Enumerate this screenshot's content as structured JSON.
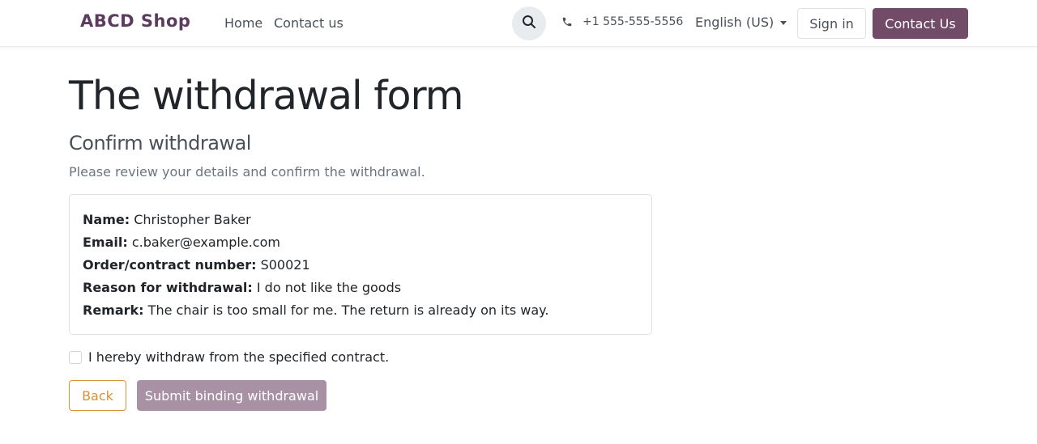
{
  "header": {
    "brand": "ABCD Shop",
    "nav": [
      {
        "label": "Home"
      },
      {
        "label": "Contact us"
      }
    ],
    "search_icon": "search-icon",
    "phone_icon": "phone-icon",
    "phone": "+1 555-555-5556",
    "language": "English (US)",
    "sign_in_label": "Sign in",
    "contact_label": "Contact Us",
    "accent_color": "#714b67"
  },
  "main": {
    "title": "The withdrawal form",
    "subtitle": "Confirm withdrawal",
    "instructions": "Please review your details and confirm the withdrawal.",
    "details": [
      {
        "label": "Name:",
        "value": "Christopher Baker"
      },
      {
        "label": "Email:",
        "value": "c.baker@example.com"
      },
      {
        "label": "Order/contract number:",
        "value": "S00021"
      },
      {
        "label": "Reason for withdrawal:",
        "value": "I do not like the goods"
      },
      {
        "label": "Remark:",
        "value": "The chair is too small for me. The return is already on its way."
      }
    ],
    "confirm_label": "I hereby withdraw from the specified contract.",
    "confirm_checked": false,
    "back_label": "Back",
    "submit_label": "Submit binding withdrawal",
    "submit_disabled": true
  }
}
